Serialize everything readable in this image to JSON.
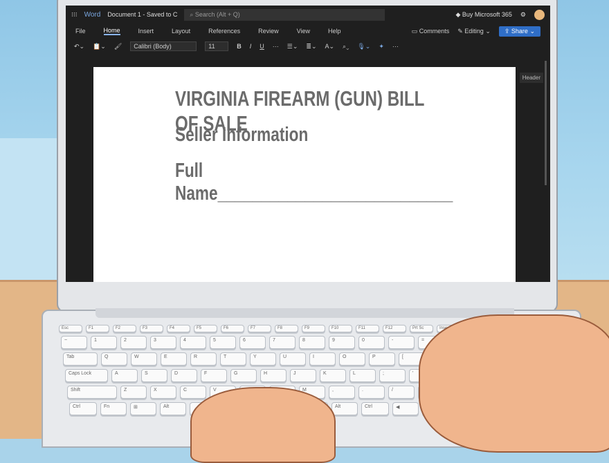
{
  "app": {
    "name": "Word",
    "doc_title": "Document 1 - Saved to C",
    "search_placeholder": "Search (Alt + Q)",
    "buy": "Buy Microsoft 365"
  },
  "menu": [
    "File",
    "Home",
    "Insert",
    "Layout",
    "References",
    "Review",
    "View",
    "Help"
  ],
  "menu_active": "Home",
  "actions": {
    "comments": "Comments",
    "editing": "Editing",
    "share": "Share"
  },
  "toolbar": {
    "font": "Calibri (Body)",
    "size": "11",
    "bold": "B",
    "italic": "I",
    "underline": "U",
    "more": "···"
  },
  "header_tag": "Header",
  "document": {
    "title": "VIRGINIA FIREARM (GUN) BILL OF SALE",
    "section": "Seller Information",
    "field": "Full Name___________________________"
  },
  "keyboard": [
    [
      "Esc",
      "F1",
      "F2",
      "F3",
      "F4",
      "F5",
      "F6",
      "F7",
      "F8",
      "F9",
      "F10",
      "F11",
      "F12",
      "Prt Sc",
      "Insert",
      "Delete"
    ],
    [
      "~",
      "1",
      "2",
      "3",
      "4",
      "5",
      "6",
      "7",
      "8",
      "9",
      "0",
      "-",
      "=",
      "Back"
    ],
    [
      "Tab",
      "Q",
      "W",
      "E",
      "R",
      "T",
      "Y",
      "U",
      "I",
      "O",
      "P",
      "[",
      "]",
      "\\"
    ],
    [
      "Caps Lock",
      "A",
      "S",
      "D",
      "F",
      "G",
      "H",
      "J",
      "K",
      "L",
      ";",
      "'",
      "Enter"
    ],
    [
      "Shift",
      "Z",
      "X",
      "C",
      "V",
      "B",
      "N",
      "M",
      ",",
      ".",
      "/",
      "Shift"
    ],
    [
      "Ctrl",
      "Fn",
      "⊞",
      "Alt",
      "",
      "Alt",
      "Ctrl",
      "◀",
      "▼",
      "▶"
    ]
  ],
  "colors": {
    "accent": "#2f6ec7",
    "screen": "#1f1f1f"
  }
}
